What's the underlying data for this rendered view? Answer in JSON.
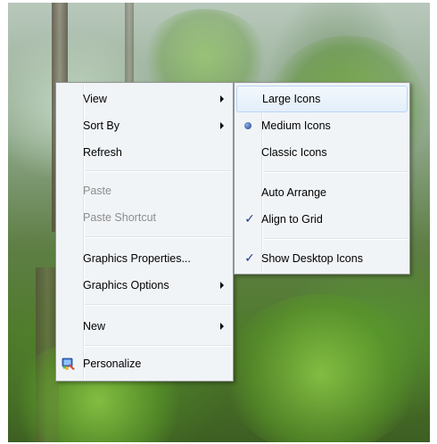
{
  "context_menu": {
    "items": [
      {
        "label": "View",
        "submenu": true,
        "enabled": true
      },
      {
        "label": "Sort By",
        "submenu": true,
        "enabled": true
      },
      {
        "label": "Refresh",
        "submenu": false,
        "enabled": true
      },
      {
        "label": "Paste",
        "submenu": false,
        "enabled": false
      },
      {
        "label": "Paste Shortcut",
        "submenu": false,
        "enabled": false
      },
      {
        "label": "Graphics Properties...",
        "submenu": false,
        "enabled": true
      },
      {
        "label": "Graphics Options",
        "submenu": true,
        "enabled": true
      },
      {
        "label": "New",
        "submenu": true,
        "enabled": true
      },
      {
        "label": "Personalize",
        "submenu": false,
        "enabled": true,
        "icon": "personalize-icon"
      }
    ]
  },
  "view_submenu": {
    "items": [
      {
        "label": "Large Icons",
        "state": "highlighted"
      },
      {
        "label": "Medium Icons",
        "state": "selected-radio"
      },
      {
        "label": "Classic Icons",
        "state": "none"
      },
      {
        "label": "Auto Arrange",
        "state": "none"
      },
      {
        "label": "Align to Grid",
        "state": "checked"
      },
      {
        "label": "Show Desktop Icons",
        "state": "checked"
      }
    ]
  },
  "symbols": {
    "check": "✓"
  },
  "colors": {
    "menu_background": "#f1f4f7",
    "highlight_border": "#b8d6fb",
    "disabled_text": "#8d8d8d",
    "check_color": "#1c3f86"
  }
}
